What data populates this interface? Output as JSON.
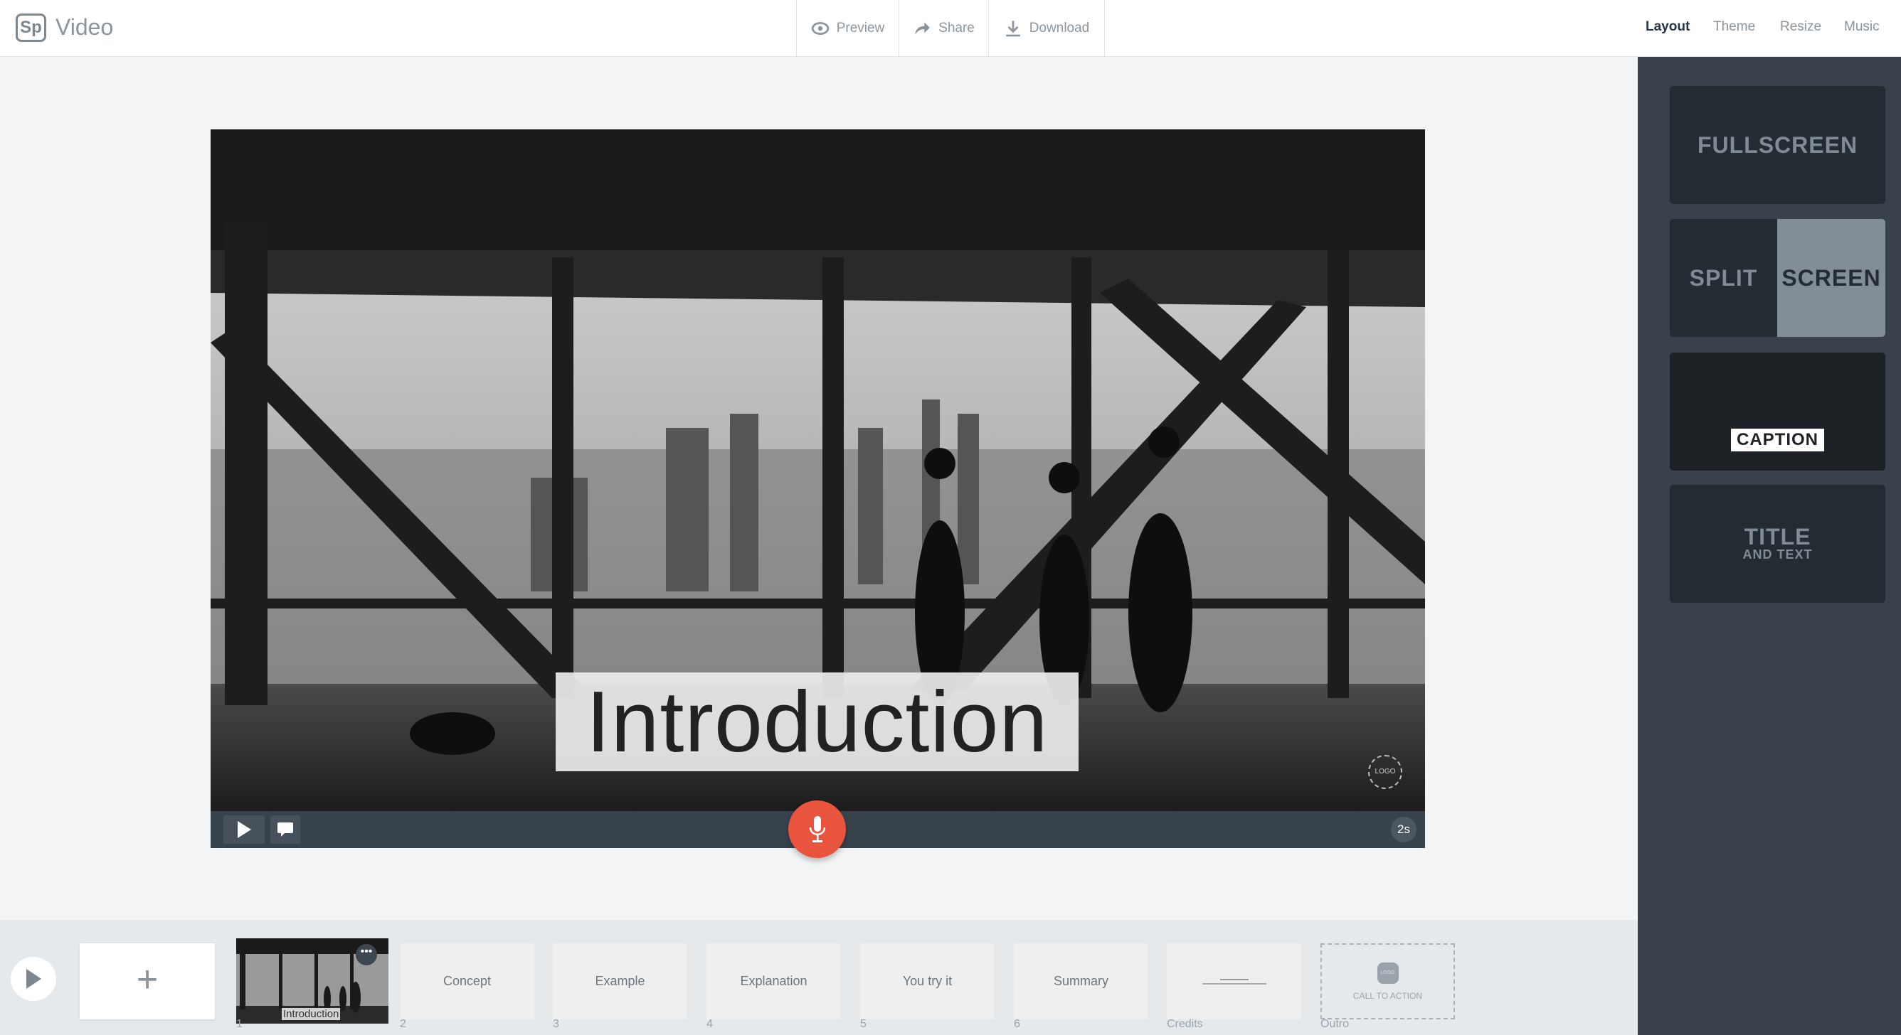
{
  "header": {
    "logo": "Sp",
    "title": "Video",
    "actions": [
      {
        "label": "Preview",
        "icon": "eye-icon"
      },
      {
        "label": "Share",
        "icon": "share-arrow-icon"
      },
      {
        "label": "Download",
        "icon": "download-icon"
      }
    ],
    "tabs": [
      {
        "label": "Layout",
        "active": true
      },
      {
        "label": "Theme"
      },
      {
        "label": "Resize"
      },
      {
        "label": "Music"
      }
    ]
  },
  "layouts": {
    "fullscreen": "FULLSCREEN",
    "split_left": "SPLIT",
    "split_right": "SCREEN",
    "caption": "CAPTION",
    "title": "TITLE",
    "title_sub": "AND TEXT"
  },
  "video": {
    "caption": "Introduction",
    "logo": "LOGO",
    "duration": "2s",
    "accent": "#e8543d"
  },
  "filmstrip": {
    "add": "+",
    "thumb_caption": "Introduction",
    "slides": [
      {
        "num": "1"
      },
      {
        "label": "Concept",
        "num": "2"
      },
      {
        "label": "Example",
        "num": "3"
      },
      {
        "label": "Explanation",
        "num": "4"
      },
      {
        "label": "You try it",
        "num": "5"
      },
      {
        "label": "Summary",
        "num": "6"
      },
      {
        "label": "",
        "num": "Credits"
      },
      {
        "label": "CALL TO ACTION",
        "num": "Outro",
        "logo": "LOGO"
      }
    ]
  }
}
